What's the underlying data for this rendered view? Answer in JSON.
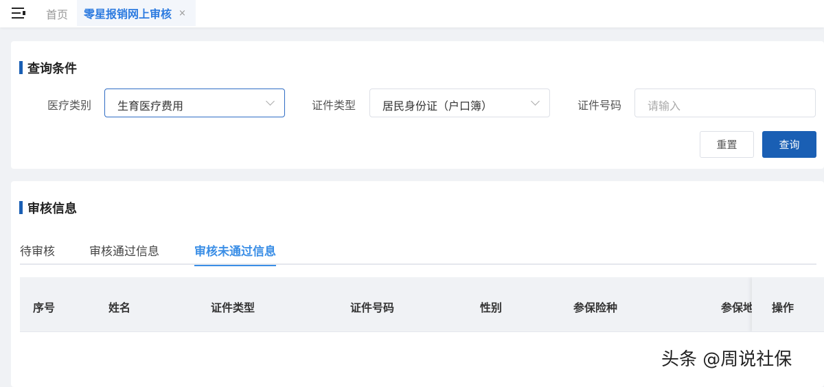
{
  "tabs": {
    "home": "首页",
    "active": "零星报销网上审核",
    "close": "×"
  },
  "query": {
    "title": "查询条件",
    "medical_type_label": "医疗类别",
    "medical_type_value": "生育医疗费用",
    "id_type_label": "证件类型",
    "id_type_value": "居民身份证（户口簿）",
    "id_number_label": "证件号码",
    "id_number_placeholder": "请输入",
    "reset": "重置",
    "search": "查询"
  },
  "review": {
    "title": "审核信息",
    "tabs": [
      "待审核",
      "审核通过信息",
      "审核未通过信息"
    ],
    "active_tab": 2,
    "columns": [
      "序号",
      "姓名",
      "证件类型",
      "证件号码",
      "性别",
      "参保险种",
      "参保地",
      "操作"
    ]
  },
  "watermark": "头条 @周说社保"
}
